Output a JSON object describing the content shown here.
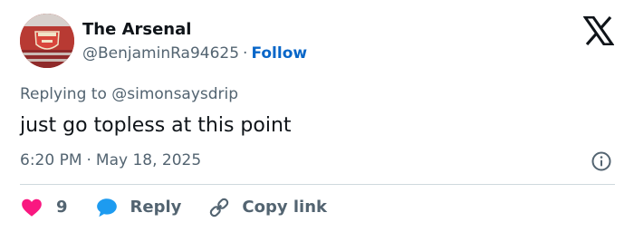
{
  "author": {
    "name": "The Arsenal",
    "handle": "@BenjaminRa94625",
    "follow_label": "Follow",
    "separator": "·"
  },
  "reply_context": {
    "prefix": "Replying to",
    "mention": "@simonsaysdrip"
  },
  "tweet": {
    "text": "just go topless at this point",
    "time": "6:20 PM",
    "separator": "·",
    "date": "May 18, 2025"
  },
  "actions": {
    "like_count": "9",
    "reply_label": "Reply",
    "copy_label": "Copy link"
  },
  "icons": {
    "logo": "x-logo-icon",
    "info": "info-icon",
    "like": "heart-icon",
    "reply": "chat-bubble-icon",
    "copy": "link-icon"
  },
  "colors": {
    "follow": "#0866c8",
    "like": "#f91880",
    "reply": "#1d9bf0",
    "secondary_text": "#536471",
    "primary_text": "#0f1419",
    "divider": "#cfd9de"
  }
}
